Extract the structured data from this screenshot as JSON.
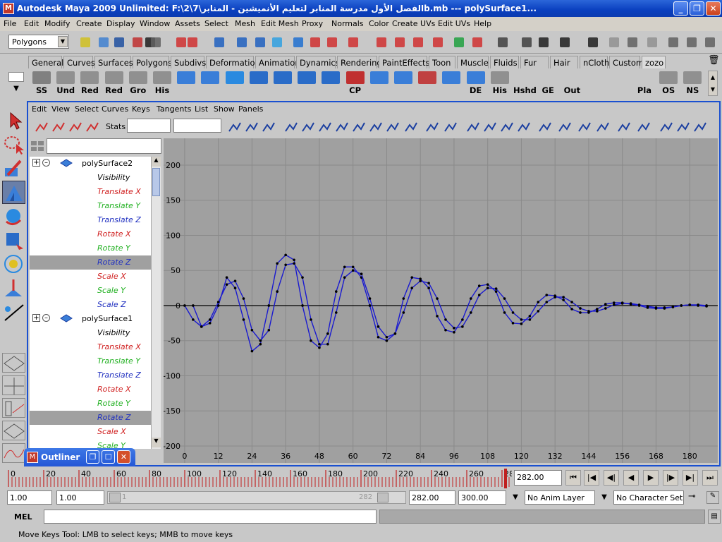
{
  "window": {
    "title": "Autodesk Maya 2009 Unlimited: F:\\2\\7\\الفصل الأول  مدرسة المنابر لتعليم الأنميشين - المنابرb.mb   ---   polySurface1...",
    "minimize": "_",
    "maximize": "❐",
    "close": "✕",
    "logo": "M"
  },
  "menubar": [
    "File",
    "Edit",
    "Modify",
    "Create",
    "Display",
    "Window",
    "Assets",
    "Select",
    "Mesh",
    "Edit Mesh",
    "Proxy",
    "Normals",
    "Color",
    "Create UVs",
    "Edit UVs",
    "Help"
  ],
  "status_line": {
    "menu_set": "Polygons"
  },
  "shelf_tabs": [
    "General",
    "Curves",
    "Surfaces",
    "Polygons",
    "Subdivs",
    "Deformation",
    "Animation",
    "Dynamics",
    "Rendering",
    "PaintEffects",
    "Toon",
    "Muscle",
    "Fluids",
    "Fur",
    "Hair",
    "nCloth",
    "Custom",
    "zozo"
  ],
  "shelf_active_tab": "zozo",
  "shelf_buttons": [
    {
      "label": "SS",
      "icon": "ss-icon",
      "color": "#808080"
    },
    {
      "label": "Und",
      "icon": "undo-curve-icon",
      "color": "#909090"
    },
    {
      "label": "Red",
      "icon": "redo-curve-icon",
      "color": "#909090"
    },
    {
      "label": "Red",
      "icon": "redo-curve-icon",
      "color": "#909090"
    },
    {
      "label": "Gro",
      "icon": "group-curve-icon",
      "color": "#909090"
    },
    {
      "label": "His",
      "icon": "history-curve-icon",
      "color": "#909090"
    },
    {
      "label": "",
      "icon": "plane-icon",
      "color": "#3a7ed8"
    },
    {
      "label": "",
      "icon": "target-plane-icon",
      "color": "#3a7ed8"
    },
    {
      "label": "",
      "icon": "sphere-icon",
      "color": "#2a8ae0"
    },
    {
      "label": "",
      "icon": "cube-icon",
      "color": "#2a6cc8"
    },
    {
      "label": "",
      "icon": "cylinder-icon",
      "color": "#2a6cc8"
    },
    {
      "label": "",
      "icon": "cone-icon",
      "color": "#2a6cc8"
    },
    {
      "label": "",
      "icon": "prism-icon",
      "color": "#2a6cc8"
    },
    {
      "label": "CP",
      "icon": "cp-icon",
      "color": "#c03030"
    },
    {
      "label": "",
      "icon": "grid-icon",
      "color": "#3a7ed8"
    },
    {
      "label": "",
      "icon": "uv-grid-icon",
      "color": "#3a7ed8"
    },
    {
      "label": "",
      "icon": "paint-icon",
      "color": "#c04040"
    },
    {
      "label": "",
      "icon": "select-plane-icon",
      "color": "#3a7ed8"
    },
    {
      "label": "DE",
      "icon": "de-icon",
      "color": "#3a7ed8"
    },
    {
      "label": "His",
      "icon": "history-icon",
      "color": "#909090"
    },
    {
      "label": "Hshd",
      "icon": "hshd-icon",
      "color": "#c8c8c8"
    },
    {
      "label": "GE",
      "icon": "ge-icon",
      "color": "#c8c8c8"
    },
    {
      "label": "Out",
      "icon": "out-icon",
      "color": "#c8c8c8"
    },
    {
      "label": "",
      "icon": "mel-script-icon",
      "color": "#c8c8c8"
    },
    {
      "label": "",
      "icon": "mel-script-icon",
      "color": "#c8c8c8"
    },
    {
      "label": "Pla",
      "icon": "pla-icon",
      "color": "#c8c8c8"
    },
    {
      "label": "OS",
      "icon": "os-icon",
      "color": "#909090"
    },
    {
      "label": "NS",
      "icon": "ns-icon",
      "color": "#909090"
    }
  ],
  "graph_editor": {
    "menu": [
      "Edit",
      "View",
      "Select",
      "Curves",
      "Keys",
      "Tangents",
      "List",
      "Show",
      "Panels"
    ],
    "stats_label": "Stats",
    "stats_field_1": "",
    "stats_field_2": ""
  },
  "outliner": {
    "rows": [
      {
        "text": "polySurface2",
        "type": "node",
        "color": "#000000",
        "selected": false
      },
      {
        "text": "Visibility",
        "type": "attr",
        "color": "#000000",
        "selected": false
      },
      {
        "text": "Translate X",
        "type": "attr",
        "color": "#d02020",
        "selected": false
      },
      {
        "text": "Translate Y",
        "type": "attr",
        "color": "#20b020",
        "selected": false
      },
      {
        "text": "Translate Z",
        "type": "attr",
        "color": "#2030c0",
        "selected": false
      },
      {
        "text": "Rotate X",
        "type": "attr",
        "color": "#d02020",
        "selected": false
      },
      {
        "text": "Rotate Y",
        "type": "attr",
        "color": "#20b020",
        "selected": false
      },
      {
        "text": "Rotate Z",
        "type": "attr",
        "color": "#2030c0",
        "selected": true
      },
      {
        "text": "Scale X",
        "type": "attr",
        "color": "#d02020",
        "selected": false
      },
      {
        "text": "Scale Y",
        "type": "attr",
        "color": "#20b020",
        "selected": false
      },
      {
        "text": "Scale Z",
        "type": "attr",
        "color": "#2030c0",
        "selected": false
      },
      {
        "text": "polySurface1",
        "type": "node",
        "color": "#000000",
        "selected": false
      },
      {
        "text": "Visibility",
        "type": "attr",
        "color": "#000000",
        "selected": false
      },
      {
        "text": "Translate X",
        "type": "attr",
        "color": "#d02020",
        "selected": false
      },
      {
        "text": "Translate Y",
        "type": "attr",
        "color": "#20b020",
        "selected": false
      },
      {
        "text": "Translate Z",
        "type": "attr",
        "color": "#2030c0",
        "selected": false
      },
      {
        "text": "Rotate X",
        "type": "attr",
        "color": "#d02020",
        "selected": false
      },
      {
        "text": "Rotate Y",
        "type": "attr",
        "color": "#20b020",
        "selected": false
      },
      {
        "text": "Rotate Z",
        "type": "attr",
        "color": "#2030c0",
        "selected": true
      },
      {
        "text": "Scale X",
        "type": "attr",
        "color": "#d02020",
        "selected": false
      },
      {
        "text": "Scale Y",
        "type": "attr",
        "color": "#20b020",
        "selected": false
      }
    ]
  },
  "chart_data": {
    "type": "line",
    "xlim": [
      -5,
      190
    ],
    "ylim": [
      -200,
      210
    ],
    "x_ticks": [
      0,
      12,
      24,
      36,
      48,
      60,
      72,
      84,
      96,
      108,
      120,
      132,
      144,
      156,
      168,
      180
    ],
    "y_ticks": [
      200,
      150,
      100,
      50,
      0,
      -50,
      -100,
      -150,
      -200
    ],
    "grid": true,
    "series": [
      {
        "color": "#1a1ad0",
        "points": [
          [
            3,
            0
          ],
          [
            6,
            -30
          ],
          [
            9,
            -25
          ],
          [
            12,
            0
          ],
          [
            15,
            40
          ],
          [
            18,
            25
          ],
          [
            21,
            -20
          ],
          [
            24,
            -65
          ],
          [
            27,
            -55
          ],
          [
            30,
            0
          ],
          [
            33,
            60
          ],
          [
            36,
            72
          ],
          [
            39,
            65
          ],
          [
            42,
            0
          ],
          [
            45,
            -50
          ],
          [
            48,
            -60
          ],
          [
            51,
            -40
          ],
          [
            54,
            20
          ],
          [
            57,
            55
          ],
          [
            60,
            55
          ],
          [
            63,
            40
          ],
          [
            66,
            0
          ],
          [
            69,
            -45
          ],
          [
            72,
            -50
          ],
          [
            75,
            -40
          ],
          [
            78,
            10
          ],
          [
            81,
            40
          ],
          [
            84,
            38
          ],
          [
            87,
            25
          ],
          [
            90,
            -15
          ],
          [
            93,
            -35
          ],
          [
            96,
            -38
          ],
          [
            99,
            -20
          ],
          [
            102,
            10
          ],
          [
            105,
            28
          ],
          [
            108,
            30
          ],
          [
            111,
            20
          ],
          [
            114,
            -10
          ],
          [
            117,
            -25
          ],
          [
            120,
            -26
          ],
          [
            123,
            -15
          ],
          [
            126,
            5
          ],
          [
            129,
            15
          ],
          [
            132,
            14
          ],
          [
            135,
            8
          ],
          [
            138,
            -5
          ],
          [
            141,
            -10
          ],
          [
            144,
            -10
          ],
          [
            147,
            -5
          ],
          [
            150,
            2
          ],
          [
            153,
            4
          ],
          [
            156,
            4
          ],
          [
            159,
            2
          ],
          [
            162,
            0
          ],
          [
            165,
            -3
          ],
          [
            168,
            -4
          ],
          [
            171,
            -4
          ],
          [
            174,
            -2
          ],
          [
            177,
            0
          ],
          [
            180,
            1
          ],
          [
            183,
            0
          ],
          [
            186,
            -1
          ]
        ]
      },
      {
        "color": "#1a1ad0",
        "points": [
          [
            0,
            0
          ],
          [
            3,
            -20
          ],
          [
            6,
            -30
          ],
          [
            9,
            -20
          ],
          [
            12,
            5
          ],
          [
            15,
            30
          ],
          [
            18,
            35
          ],
          [
            21,
            10
          ],
          [
            24,
            -35
          ],
          [
            27,
            -50
          ],
          [
            30,
            -35
          ],
          [
            33,
            20
          ],
          [
            36,
            58
          ],
          [
            39,
            60
          ],
          [
            42,
            40
          ],
          [
            45,
            -20
          ],
          [
            48,
            -55
          ],
          [
            51,
            -55
          ],
          [
            54,
            -10
          ],
          [
            57,
            40
          ],
          [
            60,
            50
          ],
          [
            63,
            45
          ],
          [
            66,
            10
          ],
          [
            69,
            -30
          ],
          [
            72,
            -45
          ],
          [
            75,
            -40
          ],
          [
            78,
            -10
          ],
          [
            81,
            25
          ],
          [
            84,
            35
          ],
          [
            87,
            32
          ],
          [
            90,
            10
          ],
          [
            93,
            -20
          ],
          [
            96,
            -32
          ],
          [
            99,
            -30
          ],
          [
            102,
            -10
          ],
          [
            105,
            15
          ],
          [
            108,
            25
          ],
          [
            111,
            24
          ],
          [
            114,
            10
          ],
          [
            117,
            -10
          ],
          [
            120,
            -20
          ],
          [
            123,
            -20
          ],
          [
            126,
            -8
          ],
          [
            129,
            5
          ],
          [
            132,
            12
          ],
          [
            135,
            12
          ],
          [
            138,
            5
          ],
          [
            141,
            -4
          ],
          [
            144,
            -8
          ],
          [
            147,
            -8
          ],
          [
            150,
            -4
          ],
          [
            153,
            1
          ],
          [
            156,
            3
          ],
          [
            159,
            3
          ],
          [
            162,
            1
          ],
          [
            165,
            -1
          ],
          [
            168,
            -3
          ],
          [
            171,
            -3
          ],
          [
            174,
            -2
          ],
          [
            177,
            0
          ],
          [
            180,
            1
          ],
          [
            183,
            1
          ],
          [
            186,
            0
          ]
        ]
      }
    ]
  },
  "time_slider": {
    "ticks": [
      0,
      20,
      40,
      60,
      80,
      100,
      120,
      140,
      160,
      180,
      200,
      220,
      240,
      260,
      280
    ],
    "current_time": "282.00"
  },
  "range_slider": {
    "start_time": "1.00",
    "range_start": "1.00",
    "range_start_inner": "1",
    "range_end_inner": "282",
    "range_end": "282.00",
    "end_time": "300.00",
    "anim_layer": "No Anim Layer",
    "character_set": "No Character Set"
  },
  "command_line": {
    "label": "MEL",
    "value": ""
  },
  "help_line": {
    "text": "Move Keys Tool: LMB to select keys; MMB to move keys"
  },
  "outliner_window": {
    "title": "Outliner"
  }
}
